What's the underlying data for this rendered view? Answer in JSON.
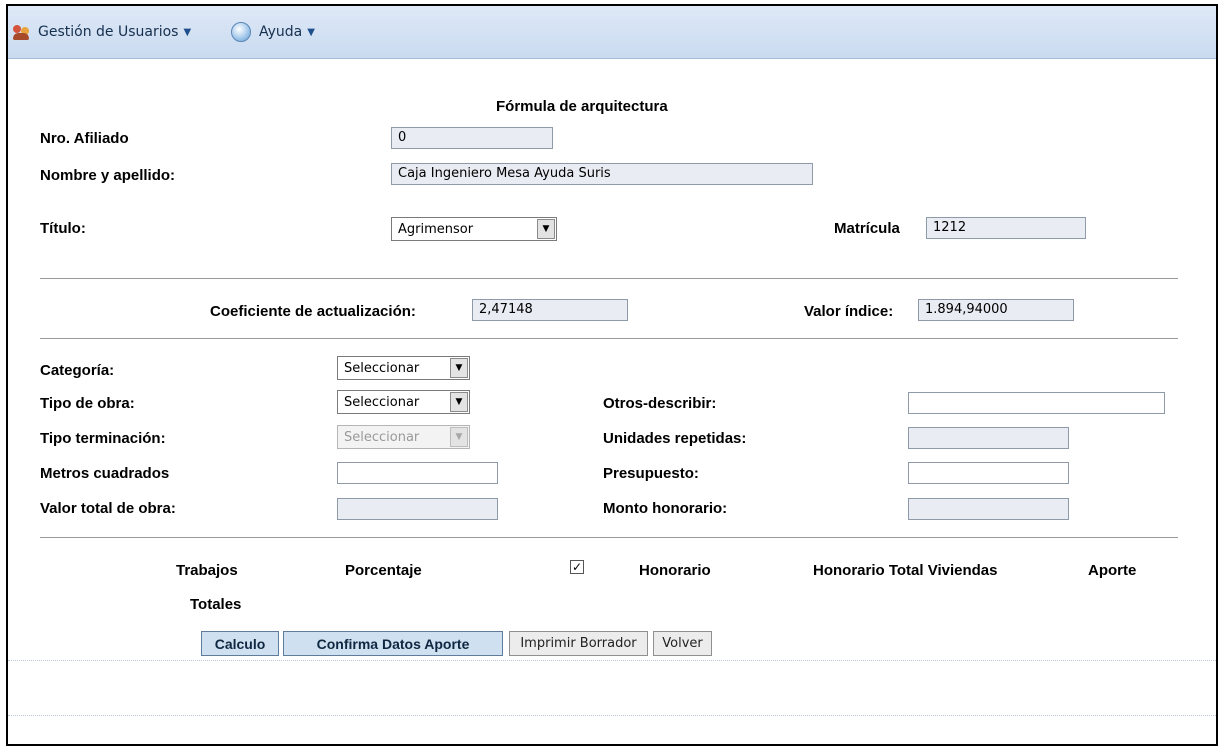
{
  "menu": {
    "users": {
      "label": "Gestión de Usuarios",
      "icon": "users-icon"
    },
    "help": {
      "label": "Ayuda",
      "icon": "help-icon"
    }
  },
  "form": {
    "title": "Fórmula de arquitectura",
    "afiliado": {
      "label": "Nro. Afiliado",
      "value": "0"
    },
    "nombre": {
      "label": "Nombre y apellido:",
      "value": "Caja Ingeniero Mesa Ayuda Suris"
    },
    "titulo": {
      "label": "Título:",
      "value": "Agrimensor"
    },
    "matricula": {
      "label": "Matrícula",
      "value": "1212"
    },
    "coeficiente": {
      "label": "Coeficiente de actualización:",
      "value": "2,47148"
    },
    "valor_indice": {
      "label": "Valor índice:",
      "value": "1.894,94000"
    },
    "categoria": {
      "label": "Categoría:",
      "value": "Seleccionar"
    },
    "tipo_obra": {
      "label": "Tipo de obra:",
      "value": "Seleccionar"
    },
    "tipo_terminacion": {
      "label": "Tipo terminación:",
      "value": "Seleccionar"
    },
    "metros": {
      "label": "Metros cuadrados",
      "value": ""
    },
    "valor_total": {
      "label": "Valor total de obra:",
      "value": ""
    },
    "otros": {
      "label": "Otros-describir:",
      "value": ""
    },
    "unidades": {
      "label": "Unidades repetidas:",
      "value": ""
    },
    "presupuesto": {
      "label": "Presupuesto:",
      "value": ""
    },
    "monto": {
      "label": "Monto honorario:",
      "value": ""
    }
  },
  "table": {
    "headers": {
      "trabajos": "Trabajos",
      "porcentaje": "Porcentaje",
      "honorario": "Honorario",
      "honorario_total": "Honorario Total Viviendas",
      "aporte": "Aporte"
    },
    "check_mark": "✓",
    "totales": "Totales"
  },
  "buttons": {
    "calculo": "Calculo",
    "confirma": "Confirma Datos Aporte",
    "imprimir": "Imprimir Borrador",
    "volver": "Volver"
  }
}
